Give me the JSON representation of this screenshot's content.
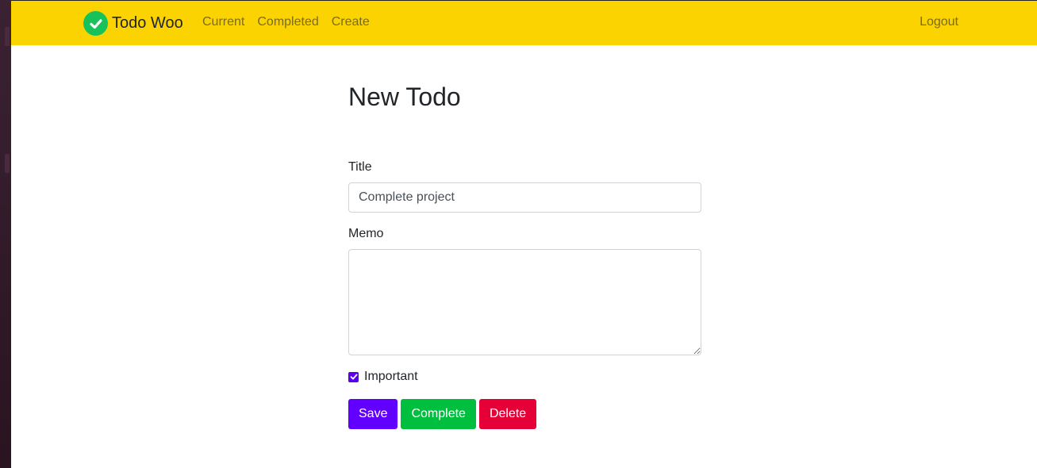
{
  "navbar": {
    "brand": "Todo Woo",
    "links": [
      "Current",
      "Completed",
      "Create"
    ],
    "logout": "Logout"
  },
  "page": {
    "title": "New Todo"
  },
  "form": {
    "title_label": "Title",
    "title_value": "Complete project",
    "memo_label": "Memo",
    "memo_value": "",
    "important_label": "Important",
    "important_checked": true
  },
  "buttons": {
    "save": "Save",
    "complete": "Complete",
    "delete": "Delete"
  },
  "colors": {
    "navbar": "#fbd300",
    "save": "#6100ff",
    "complete": "#00bf3f",
    "delete": "#e60038",
    "brand_icon": "#18c25a"
  },
  "icons": {
    "brand": "check-circle-icon"
  }
}
